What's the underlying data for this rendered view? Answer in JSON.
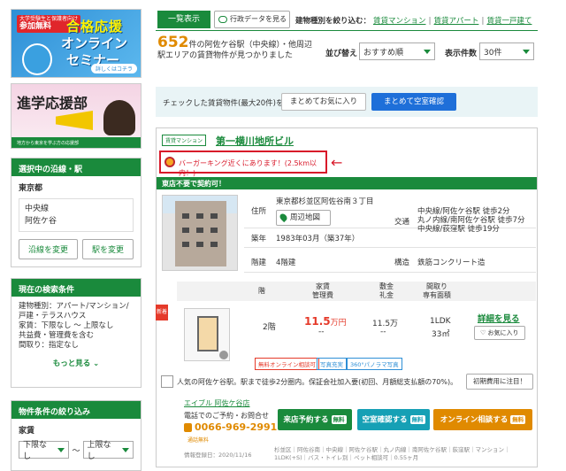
{
  "banners": {
    "seminar": {
      "tag_small": "大学受験生と保護者向け",
      "tag_big": "参加無料",
      "line1": "合格応援",
      "line2": "オンライン",
      "line3": "セミナー",
      "button": "詳しくはコチラ"
    },
    "shingaku": {
      "title": "進学応援部",
      "caption": "地方から東京を学ぶ方の応援部"
    }
  },
  "sidebar": {
    "line_box": {
      "header": "選択中の沿線・駅",
      "pref": "東京都",
      "lines": [
        "中央線",
        "阿佐ケ谷"
      ],
      "btn_line": "沿線を変更",
      "btn_station": "駅を変更"
    },
    "cond_box": {
      "header": "現在の検索条件",
      "conditions": [
        "建物種別：アパート/マンション/戸建・テラスハウス",
        "家賃：下限なし ～ 上限なし",
        "共益費・管理費を含む",
        "間取り：指定なし"
      ],
      "more": "もっと見る"
    },
    "narrow_box": {
      "header": "物件条件の絞り込み",
      "rent_label": "家賃",
      "min": "下限なし",
      "tilde": "～",
      "max": "上限なし"
    }
  },
  "tabs": {
    "list": "一覧表示",
    "data": "行政データを見る"
  },
  "filter": {
    "label": "建物種別を絞り込む：",
    "options": [
      "賃貸マンション",
      "賃貸アパート",
      "賃貸一戸建て"
    ],
    "sep": "|"
  },
  "results": {
    "count": "652",
    "text": "件の阿佐ケ谷駅（中央線）・他周辺駅エリアの賃貸物件が見つかりました"
  },
  "sort": {
    "label": "並び替え",
    "value": "おすすめ順",
    "per_page_label": "表示件数",
    "per_page_value": "30件"
  },
  "checkbar": {
    "label": "チェックした賃貸物件(最大20件)を",
    "fav": "まとめてお気に入り",
    "inquiry": "まとめて空室確認"
  },
  "property": {
    "type": "賃貸マンション",
    "name": "第一横川地所ビル",
    "burger_notice": "バーガーキング近くにあります！(2.5km以内！)",
    "arrow": "←",
    "contract_banner": "東店不要で契約可！",
    "info": {
      "address_k": "住所",
      "address_v": "東京都杉並区阿佐谷南３丁目",
      "map_btn": "周辺地図",
      "traffic_k": "交通",
      "traffic_v": [
        "中央線/阿佐ケ谷駅 徒歩2分",
        "丸ノ内線/南阿佐ケ谷駅 徒歩7分",
        "中央線/荻窪駅 徒歩19分"
      ],
      "built_k": "築年",
      "built_v": "1983年03月（築37年）",
      "floors_k": "階建",
      "floors_v": "4階建",
      "struct_k": "構造",
      "struct_v": "鉄筋コンクリート造"
    },
    "table_head": {
      "floor": "階",
      "rent": "家賃",
      "mgmt": "管理費",
      "deposit": "敷金",
      "key": "礼金",
      "layout": "間取り",
      "area": "専有面積"
    },
    "new": "新着",
    "unit": {
      "floor": "2階",
      "rent": "11.5",
      "rent_unit": "万円",
      "mgmt": "--",
      "deposit": "11.5万",
      "key": "--",
      "layout": "1LDK",
      "area": "33㎡"
    },
    "detail": "詳細を見る",
    "fav": "お気に入り",
    "chips": [
      "無料オンライン相談可",
      "写真充実",
      "360°パノラマ写真"
    ],
    "note": "人気の阿佐ケ谷駅。駅まで徒歩2分圏内。保証会社加入要(初回、月額総支払額の70%)。",
    "init_btn": "初期費用に注目！",
    "agent": "エイブル 阿佐ケ谷店",
    "tel_label": "電話でのご予約・お問合せ",
    "phone": "0066-969-2991",
    "phone_note": "通話無料",
    "btn_visit": "来店予約する",
    "btn_vacancy": "空室確認する",
    "btn_online": "オンライン相談する",
    "free": "無料",
    "info_date": "情報登録日：2020/11/16",
    "features": "杉並区｜阿佐谷南｜中央線｜阿佐ケ谷駅｜丸ノ内線｜南阿佐ケ谷駅｜荻窪駅｜マンション｜1LDK(+S)｜バス・トイレ別｜ペット相談可｜0.55ヶ月"
  },
  "colors": {
    "green": "#1a8a3c",
    "orange": "#e08a00",
    "red": "#d8192a",
    "blue": "#1e6fd9",
    "teal": "#16a0b5"
  }
}
